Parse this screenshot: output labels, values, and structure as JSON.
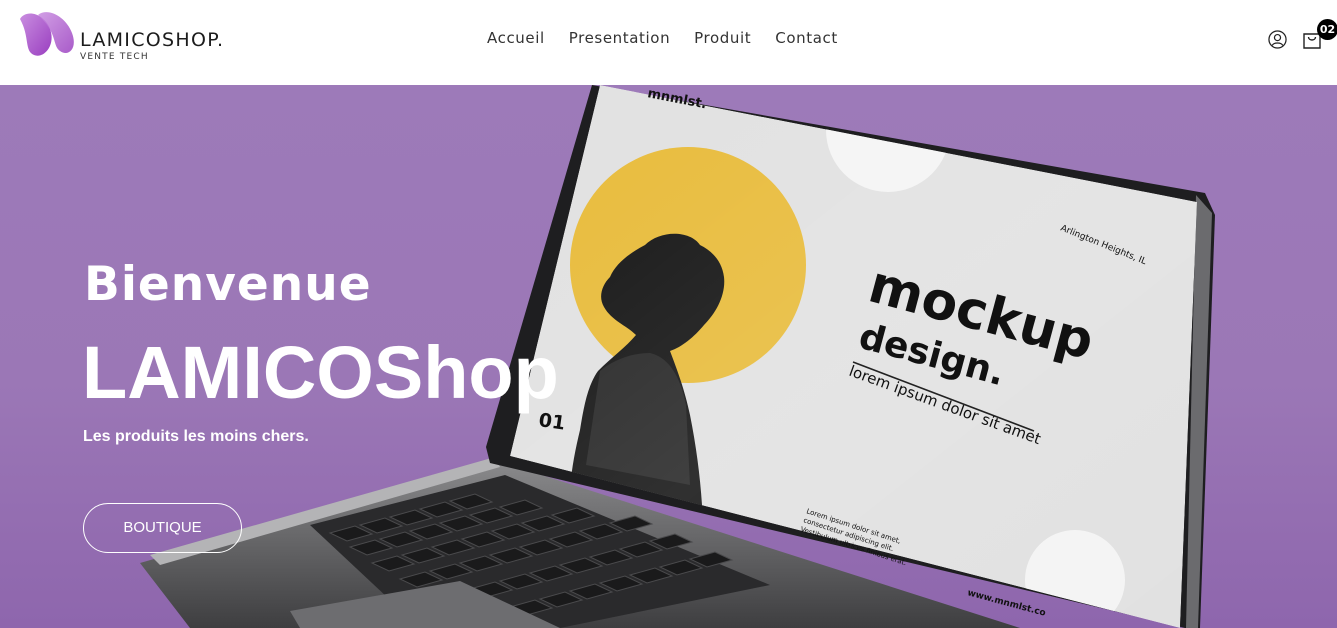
{
  "brand": {
    "name": "LAMICOSHOP.",
    "tagline": "VENTE TECH",
    "logo_icon": "petal-logo-icon",
    "accent_color": "#a454c8"
  },
  "nav": {
    "items": [
      {
        "label": "Accueil"
      },
      {
        "label": "Presentation"
      },
      {
        "label": "Produit"
      },
      {
        "label": "Contact"
      }
    ]
  },
  "header_icons": {
    "user_icon": "user-icon",
    "cart_icon": "shopping-bag-icon",
    "cart_count": "02"
  },
  "hero": {
    "title": "Bienvenue",
    "brand_name": "LAMICOShop",
    "subtitle": "Les produits les moins chers.",
    "cta_label": "BOUTIQUE",
    "background_color": "#9b77b6"
  },
  "laptop_screen": {
    "brand": "mnmlst.",
    "location": "Arlington Heights, IL",
    "heading_line1": "mockup",
    "heading_line2": "design.",
    "subheading": "lorem ipsum dolor sit amet",
    "slide_number": "01",
    "body_text": [
      "Lorem ipsum dolor sit amet,",
      "consectetur adipiscing elit.",
      "Vestibulum ultrices finibus erat."
    ],
    "website": "www.mnmlst.co"
  }
}
